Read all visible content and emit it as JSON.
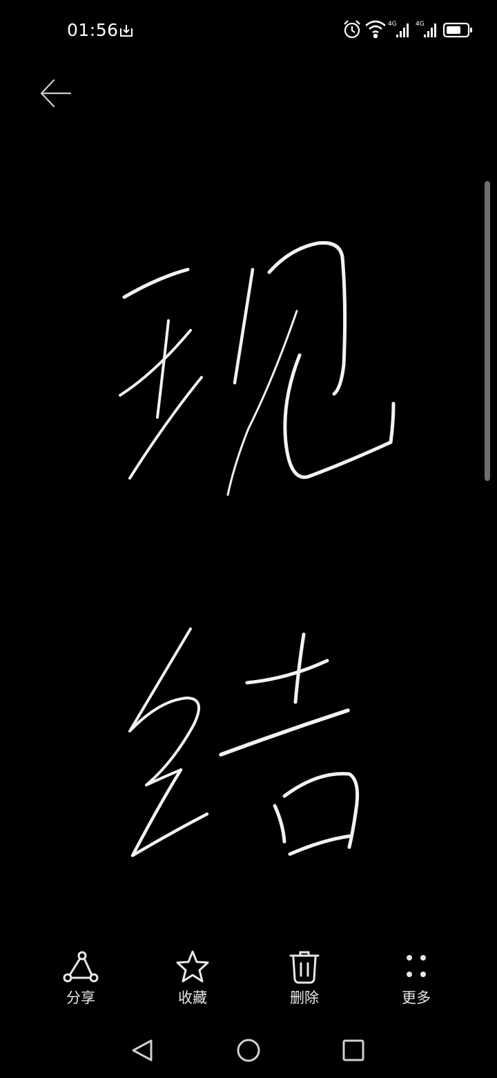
{
  "status_bar": {
    "time": "01:56",
    "icons": [
      "download-icon",
      "alarm-icon",
      "wifi-icon",
      "signal-4g-icon",
      "signal-4g-icon",
      "battery-icon"
    ],
    "network_labels": [
      "4G",
      "4G"
    ]
  },
  "header": {
    "back_icon": "arrow-left-icon"
  },
  "canvas": {
    "content": "handwritten-strokes",
    "stroke_color": "#f2f2f2"
  },
  "toolbar": {
    "items": [
      {
        "label": "分享",
        "icon": "share-icon"
      },
      {
        "label": "收藏",
        "icon": "star-icon"
      },
      {
        "label": "删除",
        "icon": "trash-icon"
      },
      {
        "label": "更多",
        "icon": "more-dots-icon"
      }
    ]
  },
  "nav_bar": {
    "icons": [
      "nav-back-icon",
      "nav-home-icon",
      "nav-recents-icon"
    ]
  },
  "colors": {
    "background": "#000000",
    "foreground": "#ffffff",
    "scrollbar": "#6f6f6f"
  }
}
